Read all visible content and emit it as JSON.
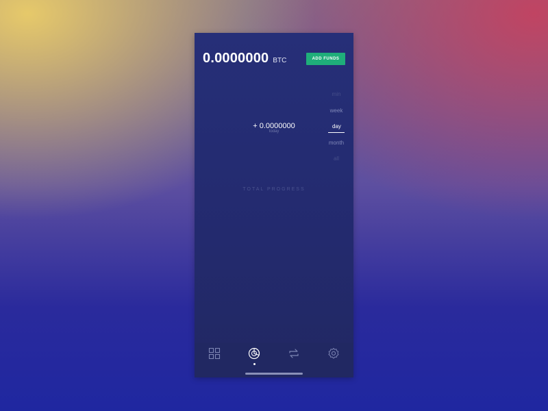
{
  "wallet": {
    "balance": "0.0000000",
    "unit": "BTC",
    "add_funds_label": "ADD FUNDS"
  },
  "periods": {
    "items": [
      "min",
      "week",
      "day",
      "month",
      "all"
    ],
    "selected": "day"
  },
  "change": {
    "value": "+ 0.0000000",
    "label": "today"
  },
  "progress": {
    "label": "TOTAL PROGRESS"
  },
  "tabbar": {
    "tabs": [
      {
        "icon": "grid-icon"
      },
      {
        "icon": "portfolio-icon",
        "active": true
      },
      {
        "icon": "exchange-icon"
      },
      {
        "icon": "settings-icon"
      }
    ]
  },
  "colors": {
    "accent_green": "#1fae7a",
    "panel": "#262f78"
  }
}
